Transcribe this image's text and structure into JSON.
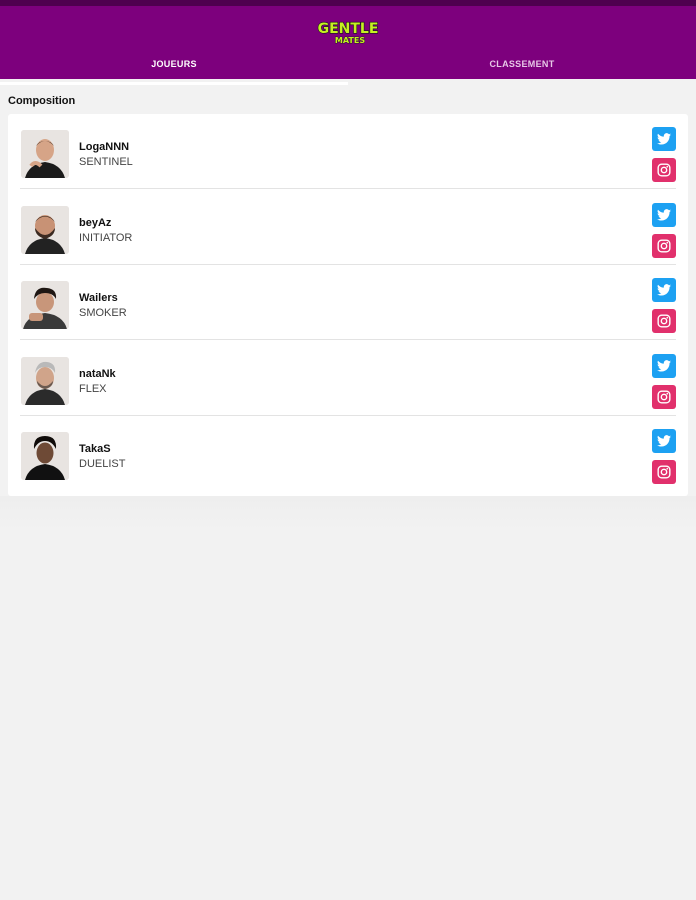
{
  "header": {
    "logo_alt": "Gentle Mates",
    "tabs": [
      {
        "label": "JOUEURS",
        "active": true
      },
      {
        "label": "CLASSEMENT",
        "active": false
      }
    ]
  },
  "section": {
    "title": "Composition"
  },
  "players": [
    {
      "name": "LogaNNN",
      "role": "SENTINEL"
    },
    {
      "name": "beyAz",
      "role": "INITIATOR"
    },
    {
      "name": "Wailers",
      "role": "SMOKER"
    },
    {
      "name": "nataNk",
      "role": "FLEX"
    },
    {
      "name": "TakaS",
      "role": "DUELIST"
    }
  ],
  "colors": {
    "brand": "#7d007d",
    "twitter": "#1da1f2",
    "instagram": "#e1306c"
  },
  "icons": {
    "twitter": "twitter-icon",
    "instagram": "instagram-icon"
  }
}
